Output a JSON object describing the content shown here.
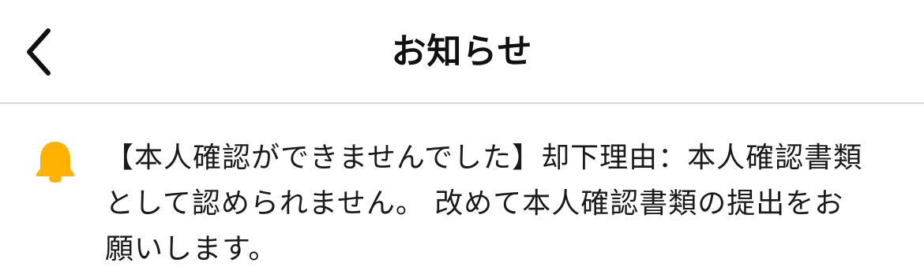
{
  "header": {
    "title": "お知らせ",
    "back_icon": "chevron-left-icon"
  },
  "notice": {
    "icon": "bell-icon",
    "icon_color": "#FFB300",
    "message": "【本人確認ができませんでした】却下理由：本人確認書類として認められません。 改めて本人確認書類の提出をお願いします。"
  }
}
